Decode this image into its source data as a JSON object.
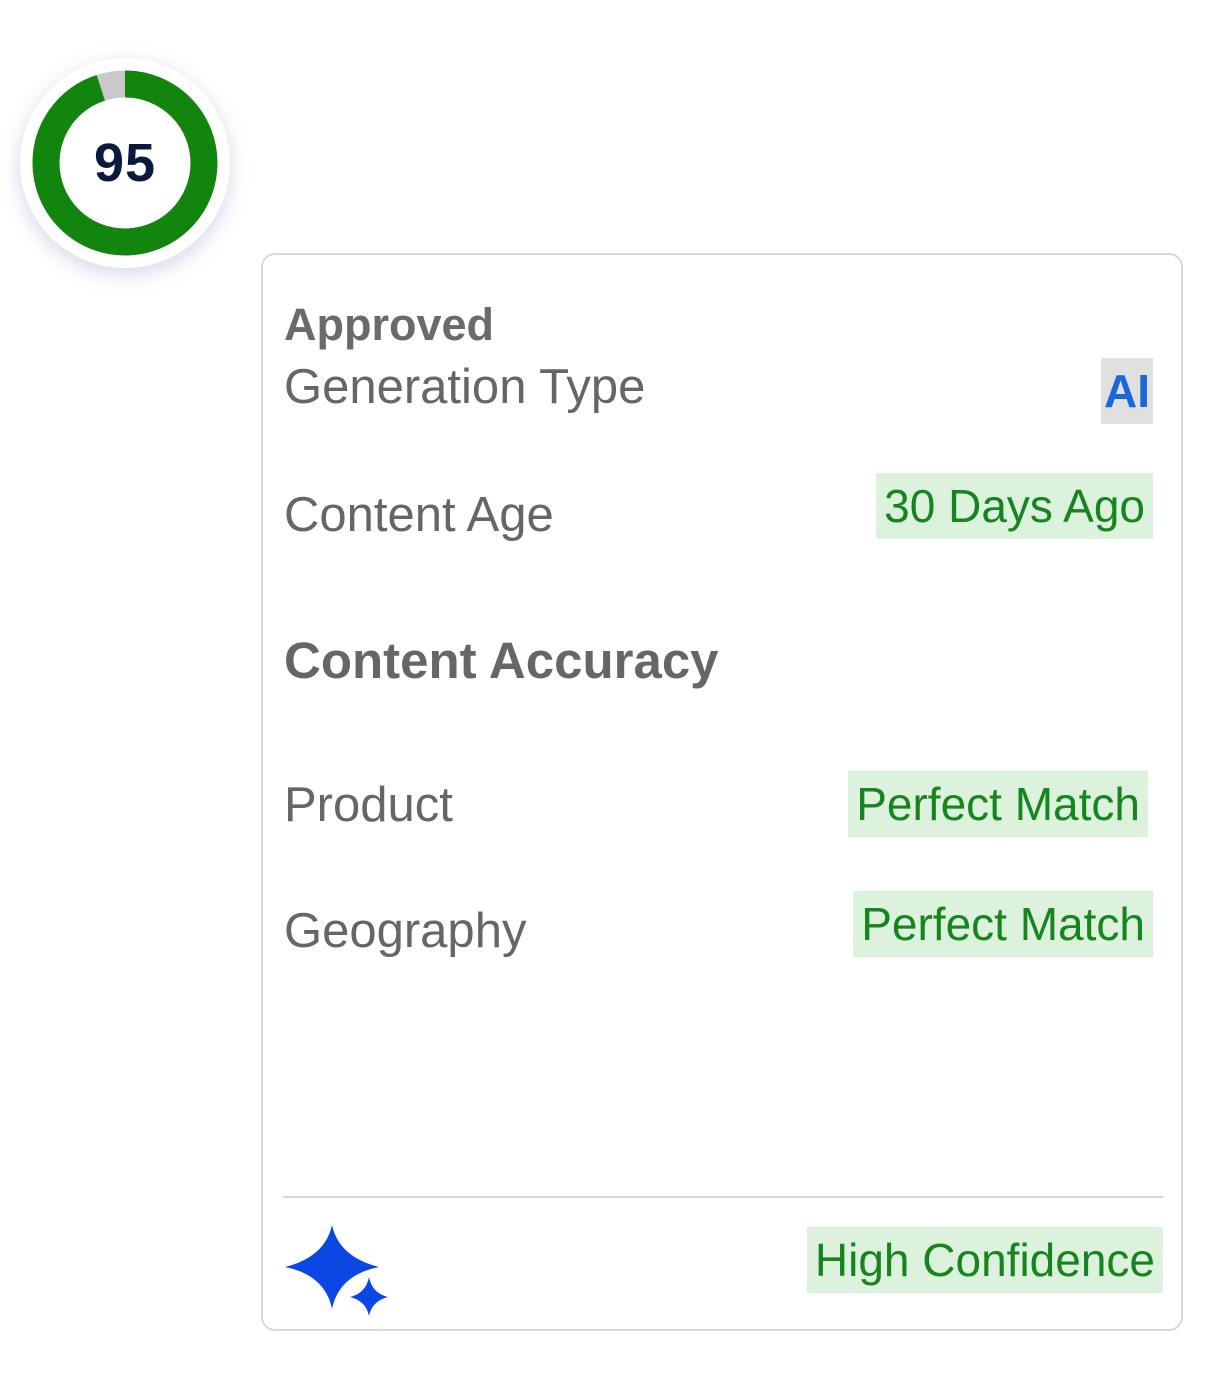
{
  "score": {
    "value": "95",
    "percent": 95,
    "ring_color": "#12850e",
    "track_color": "#c9c9c9"
  },
  "card": {
    "status": "Approved",
    "rows": {
      "generation_type": {
        "label": "Generation Type",
        "value": "AI"
      },
      "content_age": {
        "label": "Content Age",
        "value": "30 Days Ago"
      },
      "product": {
        "label": "Product",
        "value": "Perfect Match"
      },
      "geography": {
        "label": "Geography",
        "value": "Perfect Match"
      }
    },
    "section_title": "Content Accuracy",
    "footer": {
      "icon": "sparkle-icon",
      "confidence": "High Confidence"
    }
  },
  "colors": {
    "badge_bg": "#dcf2dc",
    "badge_text": "#16851f",
    "ai_text": "#1a67d8",
    "sparkle": "#0b47e3"
  }
}
